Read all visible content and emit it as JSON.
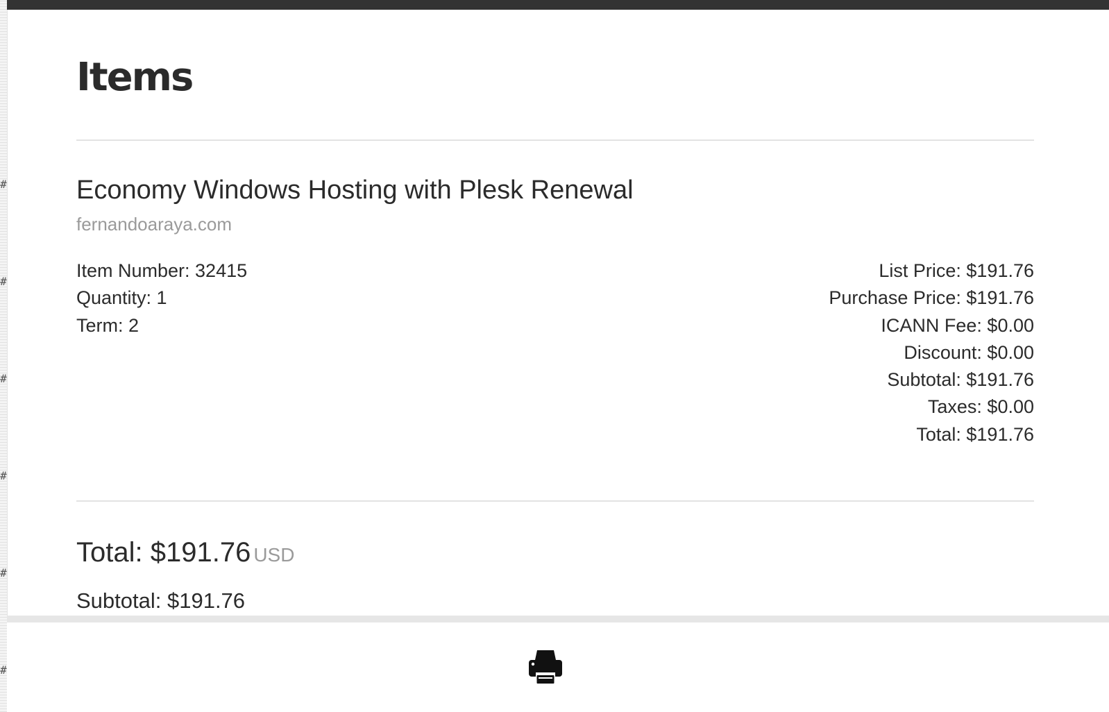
{
  "page": {
    "title": "Items"
  },
  "item": {
    "name": "Economy Windows Hosting with Plesk Renewal",
    "domain": "fernandoaraya.com",
    "details": [
      {
        "label": "Item Number",
        "value": "32415",
        "text": "Item Number: 32415"
      },
      {
        "label": "Quantity",
        "value": "1",
        "text": "Quantity: 1"
      },
      {
        "label": "Term",
        "value": "2",
        "text": "Term: 2"
      }
    ],
    "pricing": [
      {
        "label": "List Price",
        "value": "$191.76",
        "text": "List Price: $191.76"
      },
      {
        "label": "Purchase Price",
        "value": "$191.76",
        "text": "Purchase Price: $191.76"
      },
      {
        "label": "ICANN Fee",
        "value": "$0.00",
        "text": "ICANN Fee: $0.00"
      },
      {
        "label": "Discount",
        "value": "$0.00",
        "text": "Discount: $0.00"
      },
      {
        "label": "Subtotal",
        "value": "$191.76",
        "text": "Subtotal: $191.76"
      },
      {
        "label": "Taxes",
        "value": "$0.00",
        "text": "Taxes: $0.00"
      },
      {
        "label": "Total",
        "value": "$191.76",
        "text": "Total: $191.76"
      }
    ]
  },
  "summary": {
    "total_text": "Total: $191.76",
    "currency": "USD",
    "subtotal_text": "Subtotal: $191.76"
  },
  "footer": {
    "print_icon": "printer-icon"
  },
  "colors": {
    "top_bar": "#333333",
    "text": "#2b2b2b",
    "muted": "#9a9a9a",
    "divider": "#e3e3e3"
  }
}
